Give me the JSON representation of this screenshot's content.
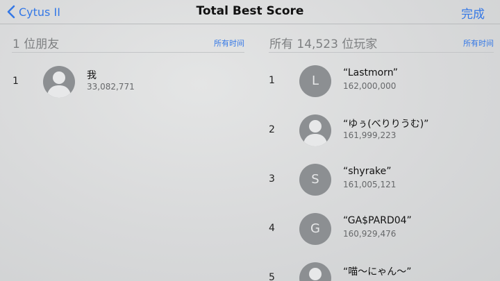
{
  "nav": {
    "back_label": "Cytus II",
    "title": "Total Best Score",
    "done_label": "完成"
  },
  "friends": {
    "header": "1 位朋友",
    "filter": "所有时间",
    "rows": [
      {
        "rank": "1",
        "name": "我",
        "score": "33,082,771"
      }
    ]
  },
  "all": {
    "header": "所有 14,523 位玩家",
    "filter": "所有时间",
    "rows": [
      {
        "rank": "1",
        "initial": "L",
        "name": "“Lastmorn”",
        "score": "162,000,000"
      },
      {
        "rank": "2",
        "initial": "",
        "name": "“ゆぅ(べりりうむ)”",
        "score": "161,999,223"
      },
      {
        "rank": "3",
        "initial": "S",
        "name": "“shyrake”",
        "score": "161,005,121"
      },
      {
        "rank": "4",
        "initial": "G",
        "name": "“GA$PARD04”",
        "score": "160,929,476"
      },
      {
        "rank": "5",
        "initial": "",
        "name": "“喵～にゃん～”",
        "score": ""
      }
    ]
  },
  "colors": {
    "accent": "#3478e6",
    "avatar": "#8c8f92"
  },
  "icons": {
    "back": "chevron-left-icon",
    "default_avatar": "person-silhouette-icon"
  }
}
